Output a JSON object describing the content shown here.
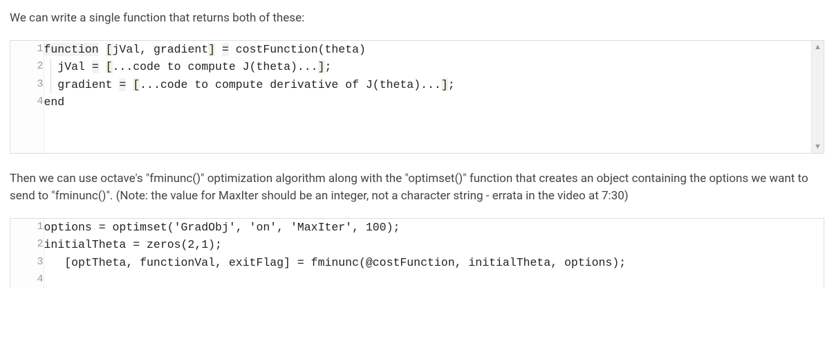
{
  "paragraph1": "We can write a single function that returns both of these:",
  "code1": {
    "lines": [
      {
        "n": "1",
        "text": "function [jVal, gradient] = costFunction(theta)"
      },
      {
        "n": "2",
        "text": "  jVal = [...code to compute J(theta)...];"
      },
      {
        "n": "3",
        "text": "  gradient = [...code to compute derivative of J(theta)...];"
      },
      {
        "n": "4",
        "text": "end"
      }
    ]
  },
  "paragraph2": "Then we can use octave's \"fminunc()\" optimization algorithm along with the \"optimset()\" function that creates an object containing the options we want to send to \"fminunc()\". (Note: the value for MaxIter should be an integer, not a character string - errata in the video at 7:30)",
  "code2": {
    "lines": [
      {
        "n": "1",
        "text": "options = optimset('GradObj', 'on', 'MaxIter', 100);"
      },
      {
        "n": "2",
        "text": "initialTheta = zeros(2,1);"
      },
      {
        "n": "3",
        "text": "   [optTheta, functionVal, exitFlag] = fminunc(@costFunction, initialTheta, options);"
      },
      {
        "n": "4",
        "text": ""
      }
    ]
  },
  "scroll": {
    "up": "▲",
    "down": "▼"
  }
}
